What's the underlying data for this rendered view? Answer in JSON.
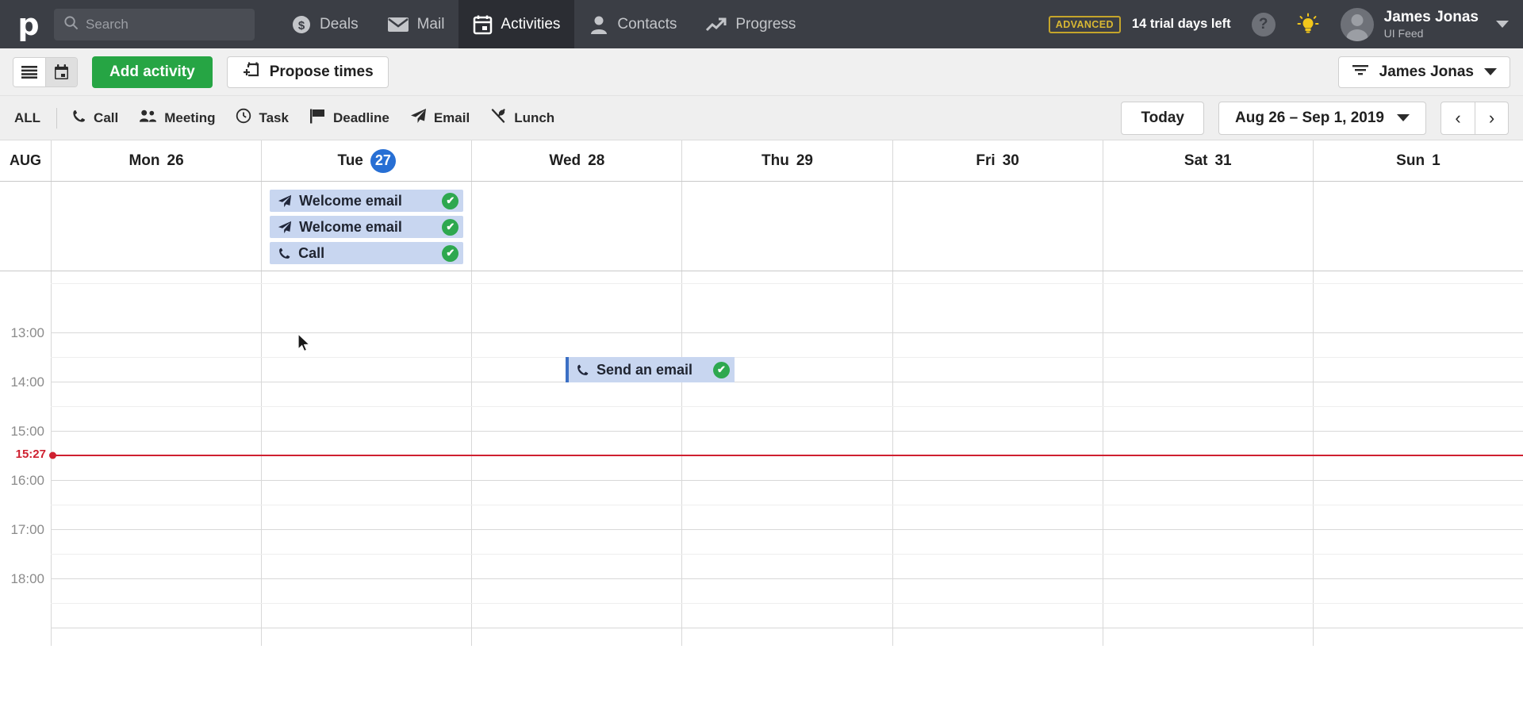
{
  "topnav": {
    "logo": "p",
    "search": {
      "placeholder": "Search",
      "value": "",
      "icon": "search-icon"
    },
    "items": [
      {
        "label": "Deals",
        "icon": "dollar-circle-icon",
        "active": false
      },
      {
        "label": "Mail",
        "icon": "envelope-icon",
        "active": false
      },
      {
        "label": "Activities",
        "icon": "calendar-icon",
        "active": true
      },
      {
        "label": "Contacts",
        "icon": "person-icon",
        "active": false
      },
      {
        "label": "Progress",
        "icon": "trend-up-icon",
        "active": false
      }
    ],
    "plan_badge": "ADVANCED",
    "trial_text": "14 trial days left",
    "help_label": "?",
    "tips_icon": "lightbulb-icon",
    "user": {
      "name": "James Jonas",
      "company": "UI Feed",
      "avatar": "avatar"
    }
  },
  "actionbar": {
    "view_list_icon": "list-view-icon",
    "view_calendar_icon": "calendar-view-icon",
    "active_view": "calendar",
    "add_activity_label": "Add activity",
    "propose_times_label": "Propose times",
    "propose_times_icon": "calendar-plus-icon",
    "user_filter_label": "James Jonas",
    "user_filter_icon": "filter-icon"
  },
  "filterbar": {
    "all_label": "ALL",
    "types": [
      {
        "label": "Call",
        "icon": "phone-icon"
      },
      {
        "label": "Meeting",
        "icon": "people-icon"
      },
      {
        "label": "Task",
        "icon": "clock-icon"
      },
      {
        "label": "Deadline",
        "icon": "flag-icon"
      },
      {
        "label": "Email",
        "icon": "paper-plane-icon"
      },
      {
        "label": "Lunch",
        "icon": "cutlery-icon"
      }
    ],
    "today_label": "Today",
    "date_range": "Aug 26 – Sep 1, 2019",
    "prev_label": "‹",
    "next_label": "›"
  },
  "calendar": {
    "month_label": "AUG",
    "days": [
      {
        "name": "Mon",
        "num": "26",
        "today": false
      },
      {
        "name": "Tue",
        "num": "27",
        "today": true
      },
      {
        "name": "Wed",
        "num": "28",
        "today": false
      },
      {
        "name": "Thu",
        "num": "29",
        "today": false
      },
      {
        "name": "Fri",
        "num": "30",
        "today": false
      },
      {
        "name": "Sat",
        "num": "31",
        "today": false
      },
      {
        "name": "Sun",
        "num": "1",
        "today": false
      }
    ],
    "allday_events": [
      {
        "day_index": 1,
        "title": "Welcome email",
        "icon": "paper-plane-icon",
        "done": true,
        "done_mark": "✔"
      },
      {
        "day_index": 1,
        "title": "Welcome email",
        "icon": "paper-plane-icon",
        "done": true,
        "done_mark": "✔"
      },
      {
        "day_index": 1,
        "title": "Call",
        "icon": "phone-icon",
        "done": true,
        "done_mark": "✔"
      }
    ],
    "hour_labels": [
      "13:00",
      "14:00",
      "15:00",
      "16:00",
      "17:00",
      "18:00"
    ],
    "now_time": "15:27",
    "timed_events": [
      {
        "day_index": 3,
        "title": "Send an email",
        "icon": "phone-icon",
        "done": true,
        "done_mark": "✔",
        "start": "13:50",
        "duration_label": ""
      }
    ]
  },
  "colors": {
    "nav_bg": "#3b3e45",
    "nav_active_bg": "#2b2d33",
    "accent_green": "#26a544",
    "event_blue": "#c8d6f0",
    "today_blue": "#276fd4",
    "now_red": "#cf2030",
    "done_green": "#2ea84f",
    "trial_gold": "#d9b833"
  }
}
